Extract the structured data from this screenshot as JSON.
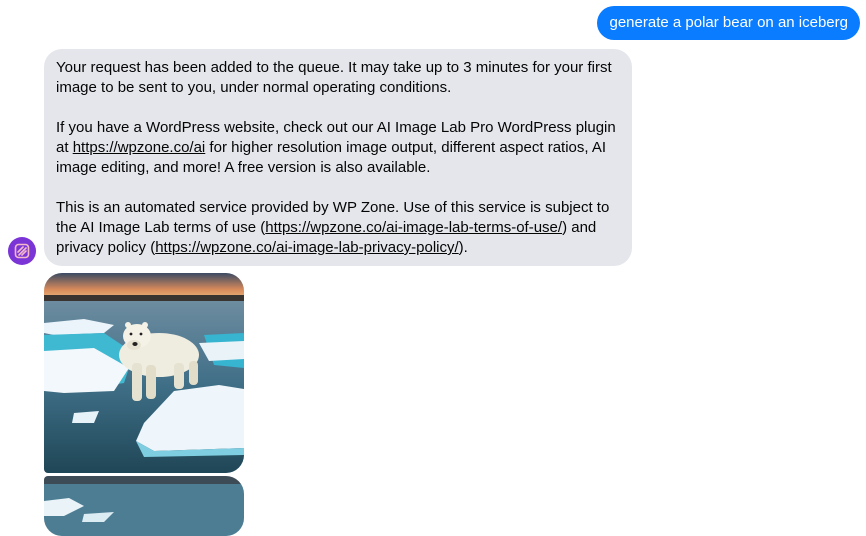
{
  "sent_message": {
    "text": "generate a polar bear on an iceberg"
  },
  "reply": {
    "p1": "Your request has been added to the queue. It may take up to 3 minutes for your first image to be sent to you, under normal operating conditions.",
    "p2_before": "If you have a WordPress website, check out our AI Image Lab Pro WordPress plugin at ",
    "p2_link": "https://wpzone.co/ai",
    "p2_after": " for higher resolution image output, different aspect ratios, AI image editing, and more! A free version is also available.",
    "p3_before": "This is an automated service provided by WP Zone. Use of this service is subject to the AI Image Lab terms of use (",
    "p3_link1": "https://wpzone.co/ai-image-lab-terms-of-use/",
    "p3_mid": ") and privacy policy (",
    "p3_link2": "https://wpzone.co/ai-image-lab-privacy-policy/",
    "p3_after": ")."
  },
  "sender": {
    "avatar_icon": "ai-image-lab-logo-icon",
    "avatar_color": "#7b35d6"
  },
  "images": [
    {
      "subject": "polar-bear-on-iceberg"
    },
    {
      "subject": "ocean-ice-floe"
    }
  ],
  "colors": {
    "sent_bubble": "#0a7cff",
    "received_bubble": "#e4e6eb",
    "text": "#050505"
  }
}
